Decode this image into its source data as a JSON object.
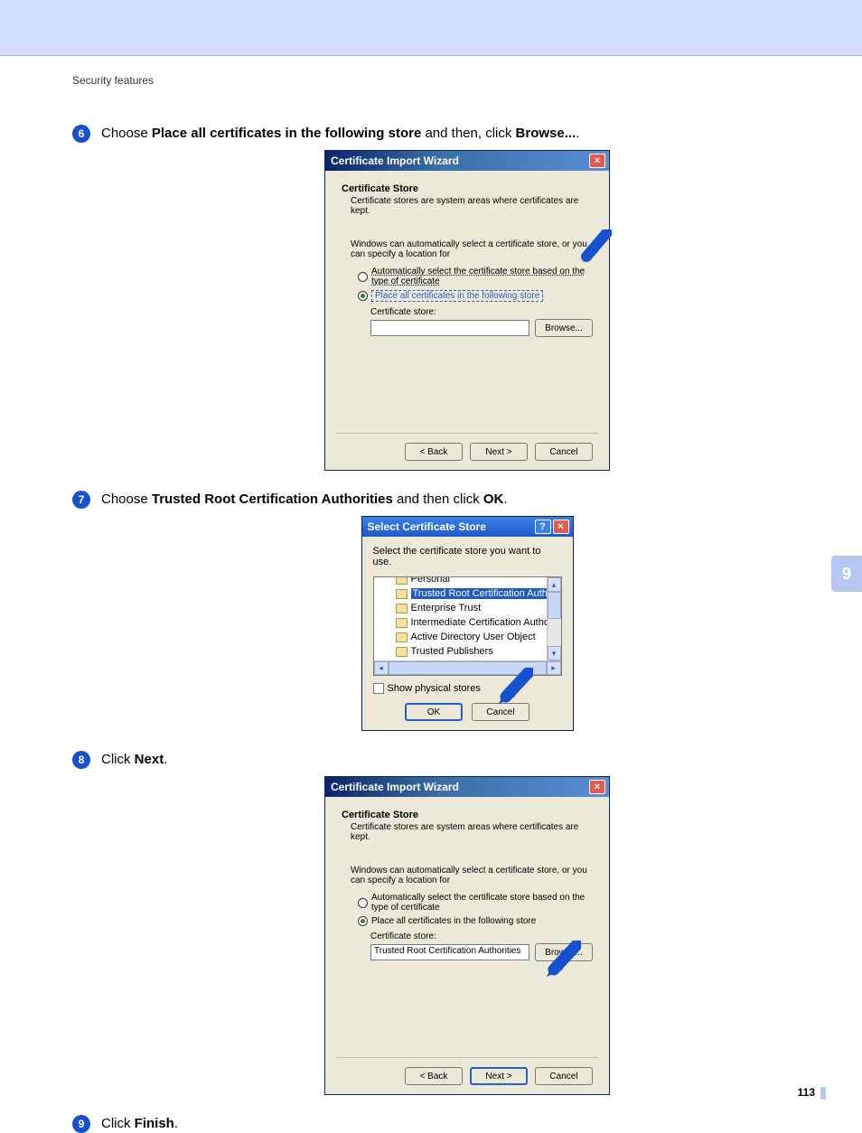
{
  "section_title": "Security features",
  "chapter_tab": "9",
  "page_number": "113",
  "steps": {
    "s6": {
      "num": "6",
      "pre": "Choose ",
      "bold1": "Place all certificates in the following store",
      "mid": " and then, click ",
      "bold2": "Browse...",
      "post": "."
    },
    "s7": {
      "num": "7",
      "pre": "Choose ",
      "bold1": "Trusted Root Certification Authorities",
      "mid": " and then click ",
      "bold2": "OK",
      "post": "."
    },
    "s8": {
      "num": "8",
      "pre": "Click ",
      "bold1": "Next",
      "post": "."
    },
    "s9": {
      "num": "9",
      "pre": "Click ",
      "bold1": "Finish",
      "post": "."
    }
  },
  "dlg_wizard": {
    "title": "Certificate Import Wizard",
    "heading": "Certificate Store",
    "sub": "Certificate stores are system areas where certificates are kept.",
    "para1": "Windows can automatically select a certificate store, or you can specify a location for",
    "opt_auto": "Automatically select the certificate store based on the type of certificate",
    "opt_place": "Place all certificates in the following store",
    "cs_label": "Certificate store:",
    "cs_value_step8": "Trusted Root Certification Authorities",
    "browse": "Browse...",
    "back": "< Back",
    "next": "Next >",
    "cancel": "Cancel"
  },
  "dlg_select": {
    "title": "Select Certificate Store",
    "lbl": "Select the certificate store you want to use.",
    "items": {
      "personal": "Personal",
      "trusted_root": "Trusted Root Certification Authorities",
      "enterprise": "Enterprise Trust",
      "intermediate": "Intermediate Certification Authorities",
      "aduo": "Active Directory User Object",
      "trusted_pub": "Trusted Publishers"
    },
    "show_physical": "Show physical stores",
    "ok": "OK",
    "cancel": "Cancel"
  }
}
